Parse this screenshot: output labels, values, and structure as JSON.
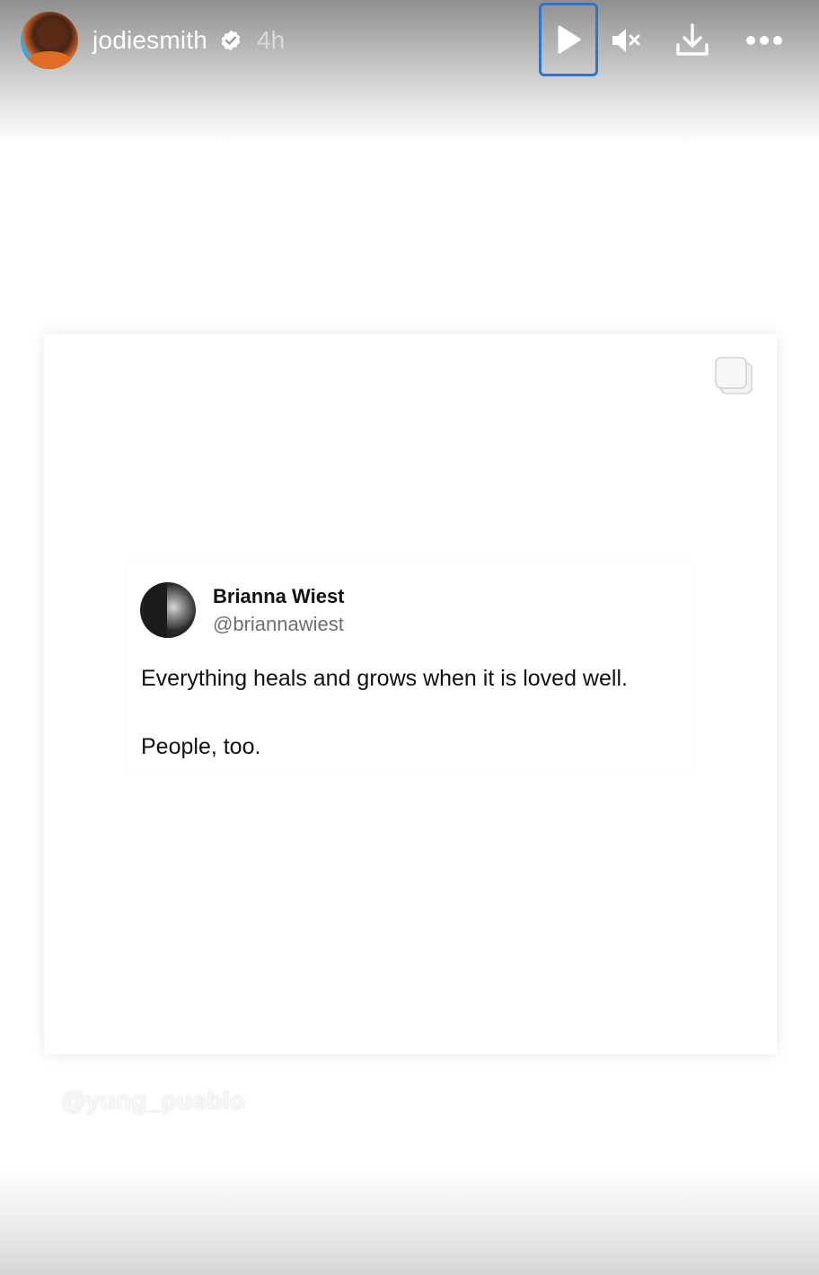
{
  "header": {
    "username": "jodiesmith",
    "time": "4h",
    "icons": {
      "verified": "verified-badge-icon",
      "play": "play-icon",
      "mute": "muted-speaker-icon",
      "download": "download-icon",
      "more": "more-dots-icon"
    }
  },
  "card": {
    "tweet": {
      "name": "Brianna Wiest",
      "handle": "@briannawiest",
      "line1": "Everything heals and grows when it is loved well.",
      "line2": "People, too."
    },
    "corner_icon": "multiple-images-icon"
  },
  "watermark": "@yung_pueblo",
  "colors": {
    "focus_outline": "#2f74c9",
    "header_text": "#ffffff",
    "time_text": "#d9d9d9"
  }
}
